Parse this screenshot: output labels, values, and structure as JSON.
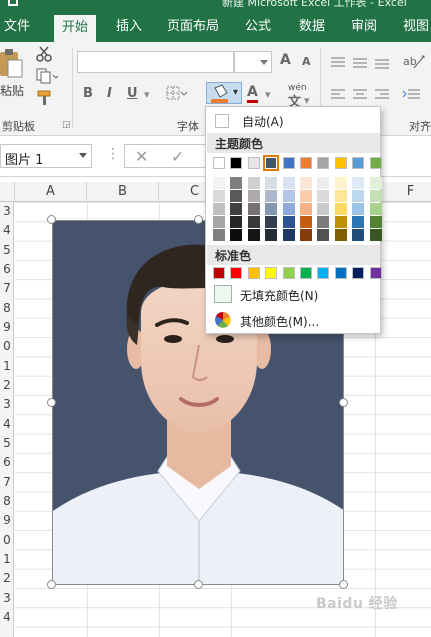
{
  "window": {
    "title": "新建 Microsoft Excel 工作表 - Excel"
  },
  "tabs": [
    {
      "label": "文件"
    },
    {
      "label": "开始"
    },
    {
      "label": "插入"
    },
    {
      "label": "页面布局"
    },
    {
      "label": "公式"
    },
    {
      "label": "数据"
    },
    {
      "label": "审阅"
    },
    {
      "label": "视图"
    }
  ],
  "ribbon": {
    "paste_label": "粘贴",
    "clipboard_group": "剪贴板",
    "font_group": "字体",
    "align_group": "对齐",
    "bold": "B",
    "italic": "I",
    "underline": "U",
    "grow_font": "A",
    "shrink_font": "A",
    "font_color": "A",
    "phonetic": "wén",
    "icons": [
      "cut-icon",
      "copy-icon",
      "format-painter-icon",
      "border-icon",
      "fill-color-icon",
      "font-color-icon",
      "align-left-icon",
      "align-center-icon",
      "align-right-icon",
      "orientation-icon"
    ]
  },
  "formula_bar": {
    "name_box": "图片 1",
    "cancel": "✕",
    "enter": "✓"
  },
  "columns": [
    "A",
    "B",
    "C",
    "F"
  ],
  "rows": [
    "3",
    "4",
    "5",
    "6",
    "7",
    "8",
    "9",
    "0",
    "1",
    "2",
    "3",
    "4",
    "5",
    "6",
    "7",
    "8",
    "9",
    "0",
    "1",
    "2",
    "3",
    "4"
  ],
  "colors": {
    "excel_green": "#217346",
    "selection_orange": "#e07a00",
    "photo_background": "#46536c"
  },
  "fill_dropdown": {
    "automatic": "自动(A)",
    "theme_header": "主题颜色",
    "theme_colors": [
      "#ffffff",
      "#000000",
      "#e7e6e6",
      "#44546a",
      "#4472c4",
      "#ed7d31",
      "#a5a5a5",
      "#ffc000",
      "#5b9bd5",
      "#70ad47"
    ],
    "theme_shades": [
      [
        "#f2f2f2",
        "#d9d9d9",
        "#bfbfbf",
        "#a6a6a6",
        "#808080"
      ],
      [
        "#7f7f7f",
        "#595959",
        "#404040",
        "#262626",
        "#0d0d0d"
      ],
      [
        "#d0cece",
        "#aeaaaa",
        "#757171",
        "#3a3838",
        "#171616"
      ],
      [
        "#d6dce4",
        "#adb9ca",
        "#8497b0",
        "#333f4f",
        "#222a35"
      ],
      [
        "#d9e2f3",
        "#b4c6e7",
        "#8eaadb",
        "#2f5496",
        "#1f3864"
      ],
      [
        "#fbe5d6",
        "#f8cbad",
        "#f4b183",
        "#c55a11",
        "#843c0c"
      ],
      [
        "#ededed",
        "#dbdbdb",
        "#c9c9c9",
        "#7b7b7b",
        "#525252"
      ],
      [
        "#fff2cc",
        "#ffe699",
        "#ffd966",
        "#bf9000",
        "#7f6000"
      ],
      [
        "#deebf7",
        "#bdd7ee",
        "#9dc3e6",
        "#2e75b6",
        "#1f4e79"
      ],
      [
        "#e2f0d9",
        "#c5e0b4",
        "#a9d18e",
        "#548235",
        "#385723"
      ]
    ],
    "standard_header": "标准色",
    "standard_colors": [
      "#c00000",
      "#ff0000",
      "#ffc000",
      "#ffff00",
      "#92d050",
      "#00b050",
      "#00b0f0",
      "#0070c0",
      "#002060",
      "#7030a0"
    ],
    "no_fill": "无填充颜色(N)",
    "more_colors": "其他颜色(M)..."
  },
  "watermark": "Baidu 经验"
}
